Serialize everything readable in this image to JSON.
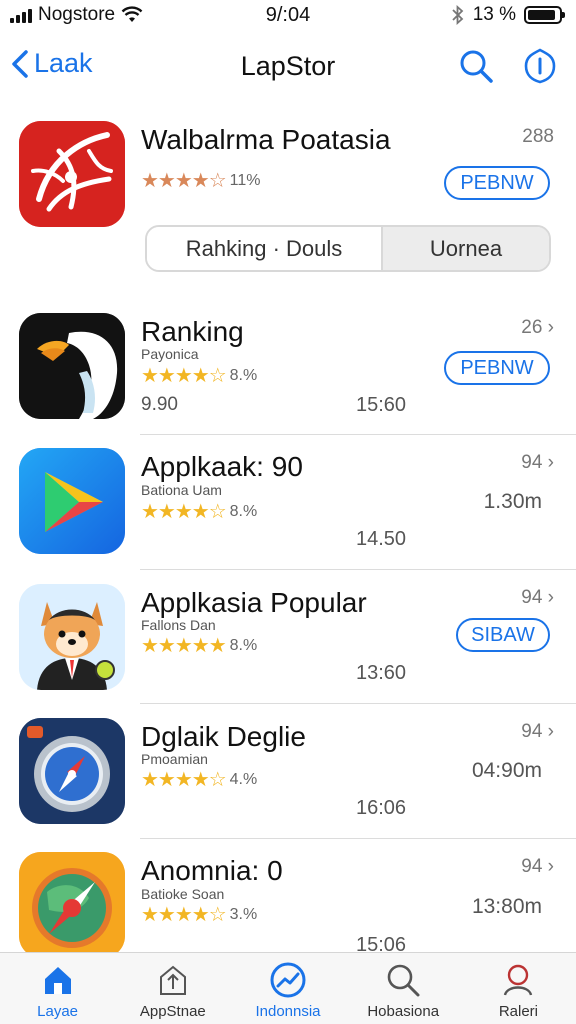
{
  "status_bar": {
    "carrier": "Nogstore",
    "time": "9/:04",
    "battery": "13 %",
    "battery_level_fraction": 0.9
  },
  "nav": {
    "back_label": "Laak",
    "title": "LapStor",
    "icons": [
      "search-icon",
      "info-icon"
    ]
  },
  "featured": {
    "title": "Walbalrma Poatasia",
    "rating_count": "11%",
    "rank": "288",
    "get_label": "PEBNW",
    "segments": [
      "Rahking · Douls",
      "Uornea"
    ]
  },
  "apps": [
    {
      "title": "Ranking",
      "subtitle": "Payonica",
      "rating_count": "8.%",
      "rank": "26",
      "button": "PEBNW",
      "meta_left": "9.90",
      "meta_mid": "15:60",
      "meta_right": "",
      "icon": "penguin-app-icon"
    },
    {
      "title": "Applkaak: 90",
      "subtitle": "Bationa Uam",
      "rating_count": "8.%",
      "rank": "94",
      "button": "",
      "meta_left": "",
      "meta_mid": "14.50",
      "meta_right": "1.30m",
      "icon": "play-app-icon"
    },
    {
      "title": "Applkasia Popular",
      "subtitle": "Fallons Dan",
      "rating_count": "8.%",
      "rank": "94",
      "button": "SIBAW",
      "meta_left": "",
      "meta_mid": "13:60",
      "meta_right": "",
      "icon": "fox-character-app-icon"
    },
    {
      "title": "Dglaik Deglie",
      "subtitle": "Pmoamian",
      "rating_count": "4.%",
      "rank": "94",
      "button": "",
      "meta_left": "",
      "meta_mid": "16:06",
      "meta_right": "04:90m",
      "icon": "compass-app-icon"
    },
    {
      "title": "Anomnia: 0",
      "subtitle": "Batioke Soan",
      "rating_count": "3.%",
      "rank": "94",
      "button": "",
      "meta_left": "",
      "meta_mid": "15:06",
      "meta_right": "13:80m",
      "icon": "navigator-app-icon"
    }
  ],
  "tabs": [
    {
      "label": "Layae",
      "icon": "home-icon",
      "active": true
    },
    {
      "label": "AppStnae",
      "icon": "upload-icon",
      "active": false
    },
    {
      "label": "Indonnsia",
      "icon": "trend-icon",
      "active": false
    },
    {
      "label": "Hobasiona",
      "icon": "search-icon",
      "active": false
    },
    {
      "label": "Raleri",
      "icon": "profile-icon",
      "active": false
    }
  ],
  "colors": {
    "accent": "#1a73e8",
    "star_gold": "#f2b624",
    "star_orange": "#d9885a"
  }
}
